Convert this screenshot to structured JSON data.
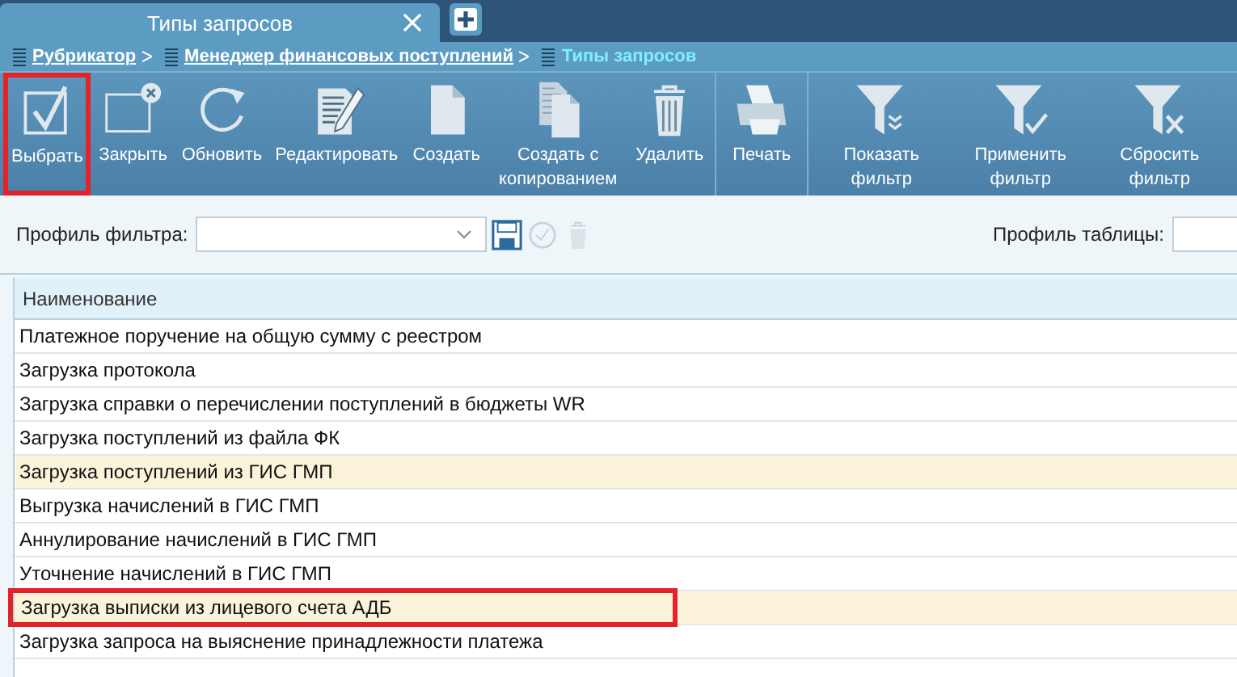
{
  "tabs": [
    {
      "label": "Типы запросов",
      "selected": true,
      "closable": true
    }
  ],
  "breadcrumbs": [
    {
      "label": "Рубрикатор",
      "current": false
    },
    {
      "label": "Менеджер финансовых поступлений",
      "current": false
    },
    {
      "label": "Типы запросов",
      "current": true
    }
  ],
  "toolbar": {
    "groups": [
      [
        {
          "kind": "check",
          "label": "Выбрать",
          "outlined": true
        },
        {
          "kind": "close",
          "label": "Закрыть",
          "outlined": false
        },
        {
          "kind": "refresh",
          "label": "Обновить",
          "outlined": false
        },
        {
          "kind": "edit",
          "label": "Редактировать",
          "outlined": false
        },
        {
          "kind": "doc",
          "label": "Создать",
          "outlined": false
        },
        {
          "kind": "copy",
          "label": "Создать с копированием",
          "outlined": false
        },
        {
          "kind": "trash",
          "label": "Удалить",
          "outlined": false
        }
      ],
      [
        {
          "kind": "print",
          "label": "Печать",
          "outlined": false
        }
      ],
      [
        {
          "kind": "filter-show",
          "label": "Показать фильтр",
          "outlined": false
        },
        {
          "kind": "filter-apply",
          "label": "Применить фильтр",
          "outlined": false
        },
        {
          "kind": "filter-reset",
          "label": "Сбросить фильтр",
          "outlined": false
        }
      ]
    ]
  },
  "filter_profile": {
    "label": "Профиль фильтра:"
  },
  "table_profile": {
    "label": "Профиль таблицы:"
  },
  "table": {
    "columns": [
      "Наименование"
    ],
    "rows": [
      {
        "name": "Платежное поручение на общую сумму с реестром",
        "selected": false,
        "outlined": false
      },
      {
        "name": "Загрузка протокола",
        "selected": false,
        "outlined": false
      },
      {
        "name": "Загрузка справки о перечислении поступлений в бюджеты WR",
        "selected": false,
        "outlined": false
      },
      {
        "name": "Загрузка поступлений из файла ФК",
        "selected": false,
        "outlined": false
      },
      {
        "name": "Загрузка поступлений из ГИС ГМП",
        "selected": true,
        "outlined": false
      },
      {
        "name": "Выгрузка начислений в ГИС ГМП",
        "selected": false,
        "outlined": false
      },
      {
        "name": "Аннулирование начислений в ГИС ГМП",
        "selected": false,
        "outlined": false
      },
      {
        "name": "Уточнение начислений в ГИС ГМП",
        "selected": false,
        "outlined": false
      },
      {
        "name": "Загрузка выписки из лицевого счета АДБ",
        "selected": true,
        "outlined": true
      },
      {
        "name": "Загрузка запроса на выяснение принадлежности платежа",
        "selected": false,
        "outlined": false
      }
    ]
  }
}
